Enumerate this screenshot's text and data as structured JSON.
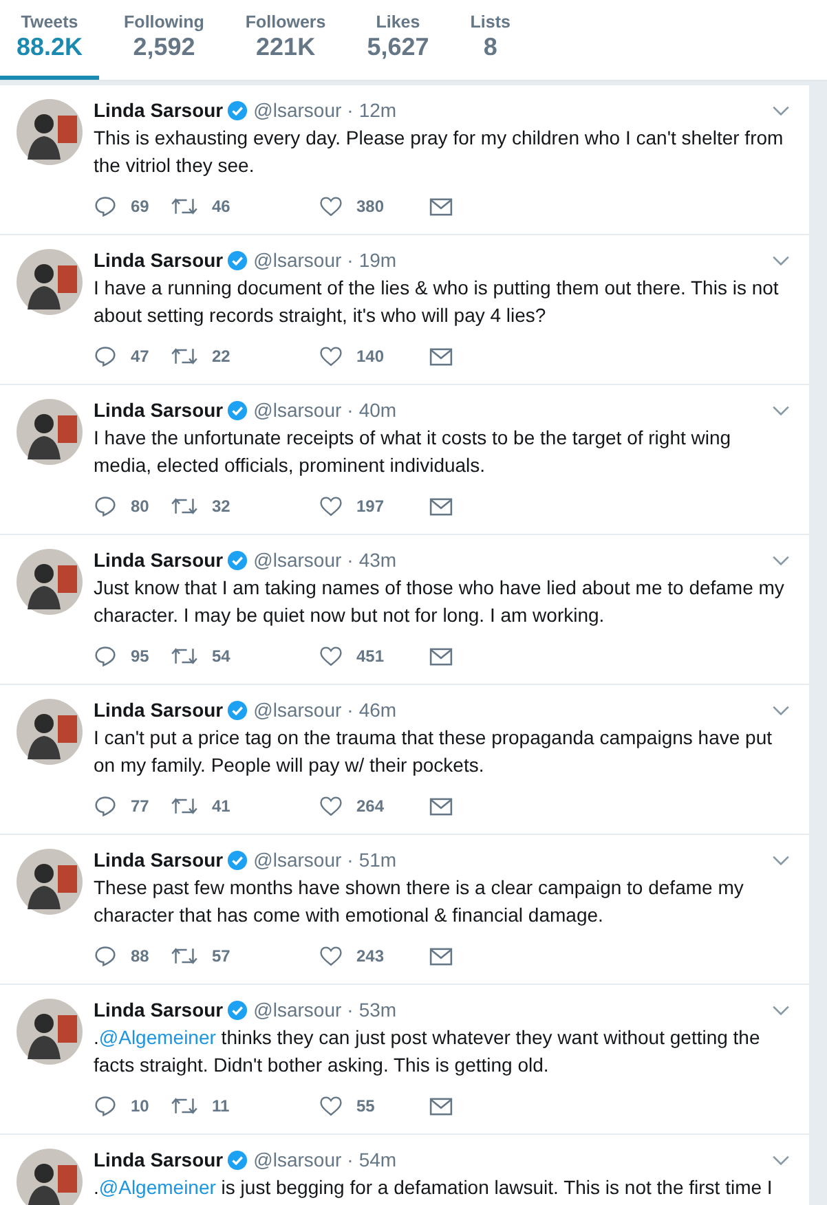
{
  "profile_nav": [
    {
      "label": "Tweets",
      "value": "88.2K",
      "selected": true
    },
    {
      "label": "Following",
      "value": "2,592",
      "selected": false
    },
    {
      "label": "Followers",
      "value": "221K",
      "selected": false
    },
    {
      "label": "Likes",
      "value": "5,627",
      "selected": false
    },
    {
      "label": "Lists",
      "value": "8",
      "selected": false
    }
  ],
  "tweets": [
    {
      "name": "Linda Sarsour",
      "verified": true,
      "handle": "@lsarsour",
      "separator": "·",
      "time": "12m",
      "text": [
        {
          "text": "This is exhausting every day. Please pray for my children who I can't shelter from the vitriol they see.",
          "link": false
        }
      ],
      "replies": "69",
      "retweets": "46",
      "likes": "380"
    },
    {
      "name": "Linda Sarsour",
      "verified": true,
      "handle": "@lsarsour",
      "separator": "·",
      "time": "19m",
      "text": [
        {
          "text": "I have a running document of the lies & who is putting them out there. This is not about setting records straight, it's who will pay 4 lies?",
          "link": false
        }
      ],
      "replies": "47",
      "retweets": "22",
      "likes": "140"
    },
    {
      "name": "Linda Sarsour",
      "verified": true,
      "handle": "@lsarsour",
      "separator": "·",
      "time": "40m",
      "text": [
        {
          "text": "I have the unfortunate receipts of what it costs to be the target of right wing media, elected officials, prominent individuals.",
          "link": false
        }
      ],
      "replies": "80",
      "retweets": "32",
      "likes": "197"
    },
    {
      "name": "Linda Sarsour",
      "verified": true,
      "handle": "@lsarsour",
      "separator": "·",
      "time": "43m",
      "text": [
        {
          "text": "Just know that I am taking names of those who have lied about me to defame my character. I may be quiet now but not for long. I am working.",
          "link": false
        }
      ],
      "replies": "95",
      "retweets": "54",
      "likes": "451"
    },
    {
      "name": "Linda Sarsour",
      "verified": true,
      "handle": "@lsarsour",
      "separator": "·",
      "time": "46m",
      "text": [
        {
          "text": "I can't put a price tag on the trauma that these propaganda campaigns have put on my family. People will pay w/ their pockets.",
          "link": false
        }
      ],
      "replies": "77",
      "retweets": "41",
      "likes": "264"
    },
    {
      "name": "Linda Sarsour",
      "verified": true,
      "handle": "@lsarsour",
      "separator": "·",
      "time": "51m",
      "text": [
        {
          "text": "These past few months have shown there is a clear campaign to defame my character that has come with emotional & financial damage.",
          "link": false
        }
      ],
      "replies": "88",
      "retweets": "57",
      "likes": "243"
    },
    {
      "name": "Linda Sarsour",
      "verified": true,
      "handle": "@lsarsour",
      "separator": "·",
      "time": "53m",
      "text": [
        {
          "text": ".",
          "link": false
        },
        {
          "text": "@Algemeiner",
          "link": true
        },
        {
          "text": " thinks they can just post whatever they want without getting the facts straight. Didn't bother asking. This is getting old.",
          "link": false
        }
      ],
      "replies": "10",
      "retweets": "11",
      "likes": "55"
    },
    {
      "name": "Linda Sarsour",
      "verified": true,
      "handle": "@lsarsour",
      "separator": "·",
      "time": "54m",
      "text": [
        {
          "text": ".",
          "link": false
        },
        {
          "text": "@Algemeiner",
          "link": true
        },
        {
          "text": " is just begging for a defamation lawsuit. This is not the first time I",
          "link": false
        }
      ]
    }
  ]
}
